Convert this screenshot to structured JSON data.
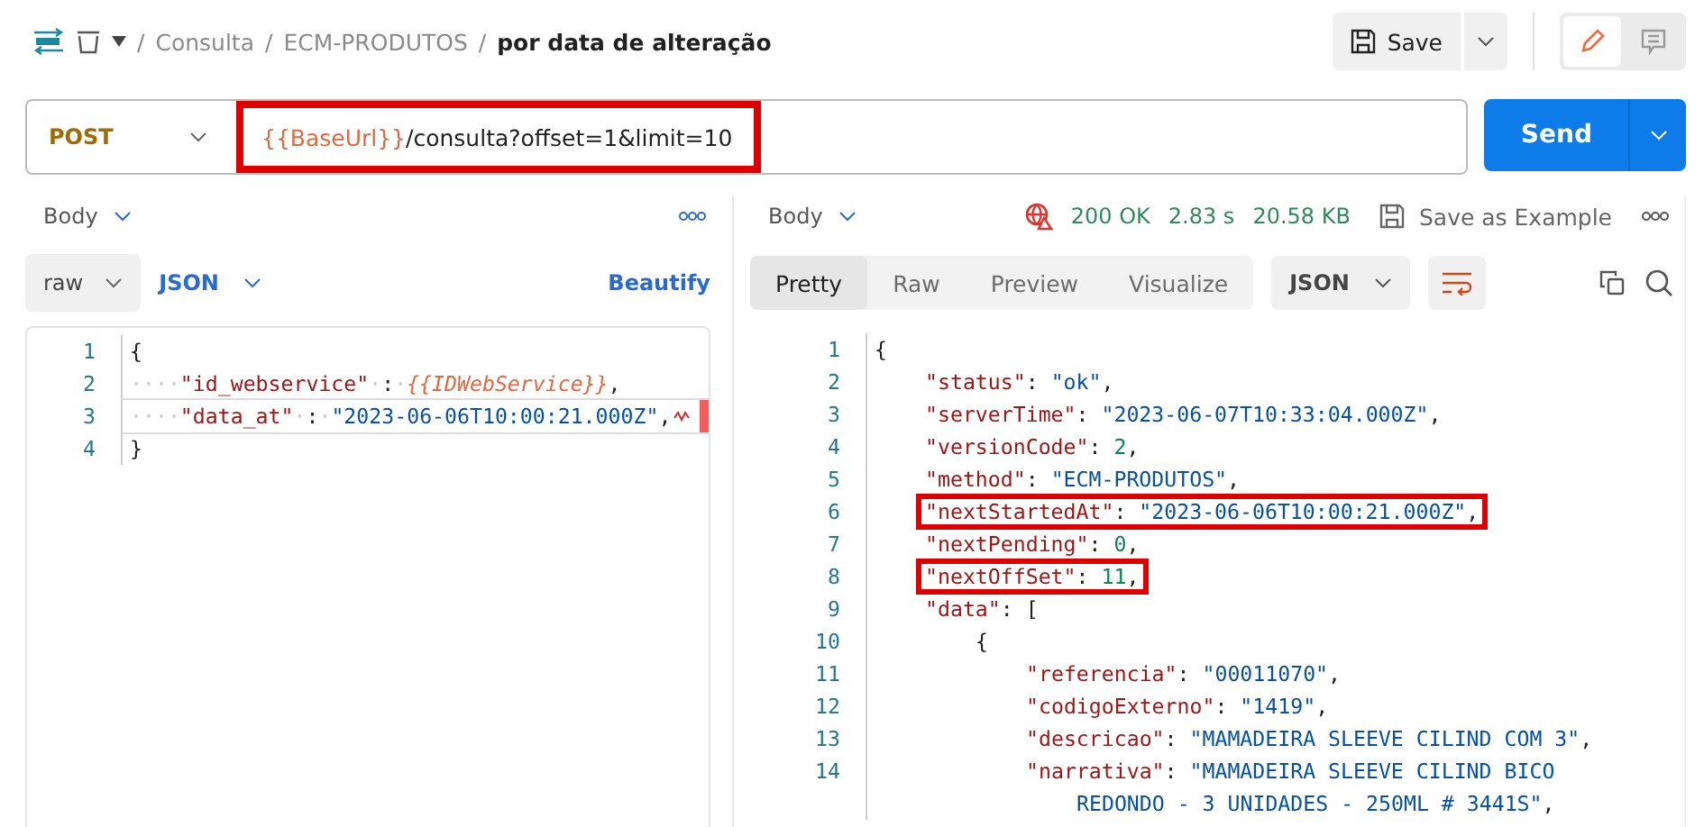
{
  "breadcrumb": {
    "separator": "/",
    "items": [
      "Consulta",
      "ECM-PRODUTOS",
      "por data de alteração"
    ]
  },
  "toolbar": {
    "save": "Save",
    "modes": [
      {
        "kind": "edit",
        "selected": true
      },
      {
        "kind": "comment",
        "selected": false
      }
    ]
  },
  "request": {
    "method": "POST",
    "url": {
      "variable": "{{BaseUrl}}",
      "path": "/consulta?offset=1&limit=10",
      "highlighted": true
    },
    "send": "Send"
  },
  "request_body": {
    "label": "Body",
    "mode": "raw",
    "format": "JSON",
    "beautify": "Beautify",
    "lines": [
      {
        "number": "1",
        "active": false,
        "error": false,
        "tokens": [
          {
            "kind": "punct",
            "text": "{"
          }
        ]
      },
      {
        "number": "2",
        "active": false,
        "error": false,
        "tokens": [
          {
            "kind": "ws",
            "text": "····"
          },
          {
            "kind": "key",
            "text": "\"id_webservice\""
          },
          {
            "kind": "ws",
            "text": "·"
          },
          {
            "kind": "punct",
            "text": ":"
          },
          {
            "kind": "ws",
            "text": "·"
          },
          {
            "kind": "variable",
            "text": "{{IDWebService}}"
          },
          {
            "kind": "punct",
            "text": ","
          }
        ]
      },
      {
        "number": "3",
        "active": true,
        "error": true,
        "tokens": [
          {
            "kind": "ws",
            "text": "····"
          },
          {
            "kind": "key",
            "text": "\"data_at\""
          },
          {
            "kind": "ws",
            "text": "·"
          },
          {
            "kind": "punct",
            "text": ":"
          },
          {
            "kind": "ws",
            "text": "·"
          },
          {
            "kind": "string",
            "text": "\"2023-06-06T10:00:21.000Z\""
          },
          {
            "kind": "punct",
            "text": ","
          }
        ]
      },
      {
        "number": "4",
        "active": false,
        "error": false,
        "tokens": [
          {
            "kind": "punct",
            "text": "}"
          }
        ]
      }
    ]
  },
  "response": {
    "label": "Body",
    "status": "200 OK",
    "time": "2.83 s",
    "size": "20.58 KB",
    "save_example": "Save as Example",
    "tabs": [
      {
        "label": "Pretty",
        "selected": true
      },
      {
        "label": "Raw",
        "selected": false
      },
      {
        "label": "Preview",
        "selected": false
      },
      {
        "label": "Visualize",
        "selected": false
      }
    ],
    "format": "JSON",
    "lines": [
      {
        "number": "1",
        "highlighted": false,
        "tokens": [
          {
            "kind": "punct",
            "text": "{"
          }
        ],
        "children": [
          {
            "number": "2",
            "highlighted": false,
            "tokens": [
              {
                "kind": "key",
                "text": "\"status\""
              },
              {
                "kind": "punct",
                "text": ": "
              },
              {
                "kind": "string",
                "text": "\"ok\""
              },
              {
                "kind": "punct",
                "text": ","
              }
            ]
          },
          {
            "number": "3",
            "highlighted": false,
            "tokens": [
              {
                "kind": "key",
                "text": "\"serverTime\""
              },
              {
                "kind": "punct",
                "text": ": "
              },
              {
                "kind": "string",
                "text": "\"2023-06-07T10:33:04.000Z\""
              },
              {
                "kind": "punct",
                "text": ","
              }
            ]
          },
          {
            "number": "4",
            "highlighted": false,
            "tokens": [
              {
                "kind": "key",
                "text": "\"versionCode\""
              },
              {
                "kind": "punct",
                "text": ": "
              },
              {
                "kind": "number",
                "text": "2"
              },
              {
                "kind": "punct",
                "text": ","
              }
            ]
          },
          {
            "number": "5",
            "highlighted": false,
            "tokens": [
              {
                "kind": "key",
                "text": "\"method\""
              },
              {
                "kind": "punct",
                "text": ": "
              },
              {
                "kind": "string",
                "text": "\"ECM-PRODUTOS\""
              },
              {
                "kind": "punct",
                "text": ","
              }
            ]
          },
          {
            "number": "6",
            "highlighted": true,
            "tokens": [
              {
                "kind": "key",
                "text": "\"nextStartedAt\""
              },
              {
                "kind": "punct",
                "text": ": "
              },
              {
                "kind": "string",
                "text": "\"2023-06-06T10:00:21.000Z\""
              },
              {
                "kind": "punct",
                "text": ","
              }
            ]
          },
          {
            "number": "7",
            "highlighted": false,
            "tokens": [
              {
                "kind": "key",
                "text": "\"nextPending\""
              },
              {
                "kind": "punct",
                "text": ": "
              },
              {
                "kind": "number",
                "text": "0"
              },
              {
                "kind": "punct",
                "text": ","
              }
            ]
          },
          {
            "number": "8",
            "highlighted": true,
            "tokens": [
              {
                "kind": "key",
                "text": "\"nextOffSet\""
              },
              {
                "kind": "punct",
                "text": ": "
              },
              {
                "kind": "number",
                "text": "11"
              },
              {
                "kind": "punct",
                "text": ","
              }
            ]
          },
          {
            "number": "9",
            "highlighted": false,
            "tokens": [
              {
                "kind": "key",
                "text": "\"data\""
              },
              {
                "kind": "punct",
                "text": ": ["
              }
            ],
            "children": [
              {
                "number": "10",
                "highlighted": false,
                "tokens": [
                  {
                    "kind": "punct",
                    "text": "{"
                  }
                ],
                "children": [
                  {
                    "number": "11",
                    "highlighted": false,
                    "tokens": [
                      {
                        "kind": "key",
                        "text": "\"referencia\""
                      },
                      {
                        "kind": "punct",
                        "text": ": "
                      },
                      {
                        "kind": "string",
                        "text": "\"00011070\""
                      },
                      {
                        "kind": "punct",
                        "text": ","
                      }
                    ]
                  },
                  {
                    "number": "12",
                    "highlighted": false,
                    "tokens": [
                      {
                        "kind": "key",
                        "text": "\"codigoExterno\""
                      },
                      {
                        "kind": "punct",
                        "text": ": "
                      },
                      {
                        "kind": "string",
                        "text": "\"1419\""
                      },
                      {
                        "kind": "punct",
                        "text": ","
                      }
                    ]
                  },
                  {
                    "number": "13",
                    "highlighted": false,
                    "tokens": [
                      {
                        "kind": "key",
                        "text": "\"descricao\""
                      },
                      {
                        "kind": "punct",
                        "text": ": "
                      },
                      {
                        "kind": "string",
                        "text": "\"MAMADEIRA SLEEVE CILIND COM 3\""
                      },
                      {
                        "kind": "punct",
                        "text": ","
                      }
                    ]
                  },
                  {
                    "number": "14",
                    "highlighted": false,
                    "tokens": [
                      {
                        "kind": "key",
                        "text": "\"narrativa\""
                      },
                      {
                        "kind": "punct",
                        "text": ": "
                      },
                      {
                        "kind": "string",
                        "text": "\"MAMADEIRA SLEEVE CILIND BICO"
                      }
                    ],
                    "wrapped_tokens": [
                      {
                        "kind": "string",
                        "text": "REDONDO - 3 UNIDADES - 250ML # 3441S\""
                      },
                      {
                        "kind": "punct",
                        "text": ","
                      }
                    ]
                  }
                ]
              }
            ]
          }
        ]
      }
    ]
  }
}
